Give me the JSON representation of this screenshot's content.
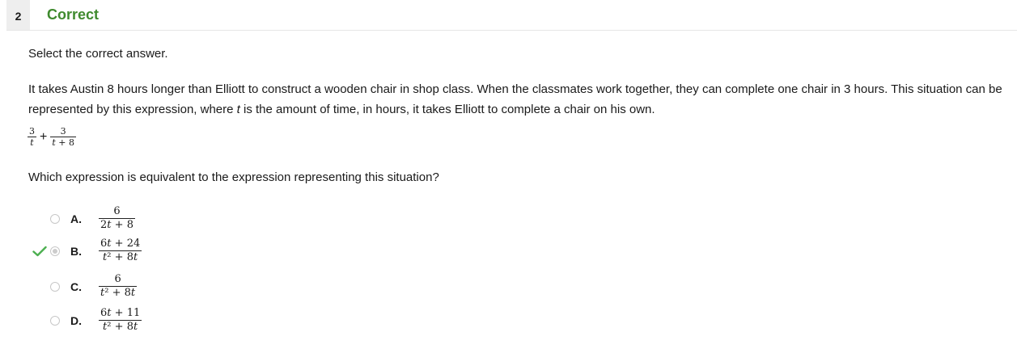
{
  "header": {
    "question_number": "2",
    "status": "Correct"
  },
  "instruction": "Select the correct answer.",
  "stem": {
    "part1": "It takes Austin 8 hours longer than Elliott to construct a wooden chair in shop class. When the classmates work together, they can complete one chair in 3 hours. This situation can be represented by this expression, where ",
    "variable": "t",
    "part2": " is the amount of time, in hours, it takes Elliott to complete a chair on his own."
  },
  "expression": {
    "term1_num": "3",
    "term1_den": "t",
    "plus": "+",
    "term2_num": "3",
    "term2_den": "t + 8"
  },
  "question": "Which expression is equivalent to the expression representing this situation?",
  "options": [
    {
      "letter": "A.",
      "num": "6",
      "den": "2t + 8",
      "selected": false,
      "correct": false
    },
    {
      "letter": "B.",
      "num": "6t + 24",
      "den": "t² + 8t",
      "selected": true,
      "correct": true
    },
    {
      "letter": "C.",
      "num": "6",
      "den": "t² + 8t",
      "selected": false,
      "correct": false
    },
    {
      "letter": "D.",
      "num": "6t + 11",
      "den": "t² + 8t",
      "selected": false,
      "correct": false
    }
  ],
  "colors": {
    "correct_green": "#3f8a2e",
    "check_green": "#4caf50"
  }
}
